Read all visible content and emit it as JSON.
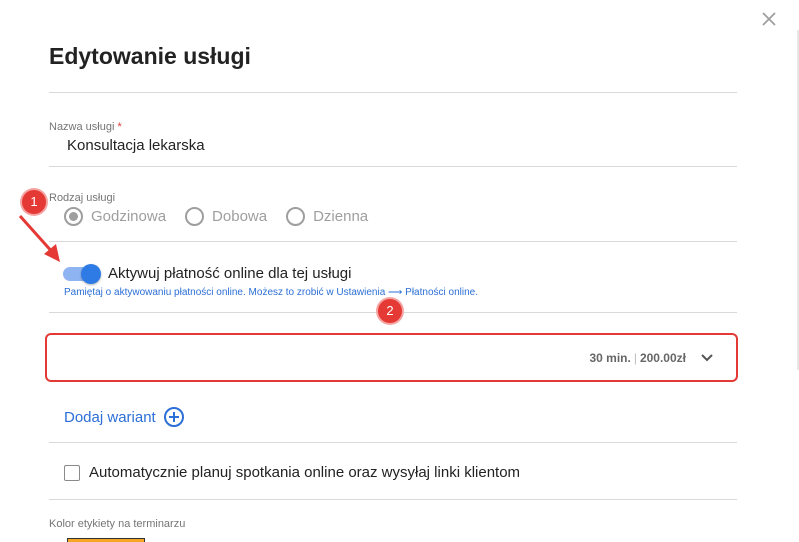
{
  "dialog": {
    "title": "Edytowanie usługi",
    "close_label": "×"
  },
  "service_name": {
    "label": "Nazwa usługi",
    "required_mark": "*",
    "value": "Konsultacja lekarska"
  },
  "service_type": {
    "label": "Rodzaj usługi",
    "options": [
      {
        "label": "Godzinowa",
        "checked": true
      },
      {
        "label": "Dobowa",
        "checked": false
      },
      {
        "label": "Dzienna",
        "checked": false
      }
    ]
  },
  "online_payment": {
    "enabled": true,
    "label": "Aktywuj płatność online dla tej usługi",
    "hint": "Pamiętaj o aktywowaniu płatności online. Możesz to zrobić w Ustawienia ⟶ Płatności online."
  },
  "variant": {
    "duration": "30 min.",
    "separator": "|",
    "price": "200.00zł"
  },
  "add_variant": {
    "label": "Dodaj wariant"
  },
  "auto_schedule": {
    "checked": false,
    "label": "Automatycznie planuj spotkania online oraz wysyłaj linki klientom"
  },
  "label_color": {
    "label": "Kolor etykiety na terminarzu",
    "color": "#f5a623"
  },
  "annotations": {
    "badge_1": "1",
    "badge_2": "2"
  },
  "colors": {
    "accent_blue": "#2c6fd6",
    "highlight_red": "#e53935"
  }
}
